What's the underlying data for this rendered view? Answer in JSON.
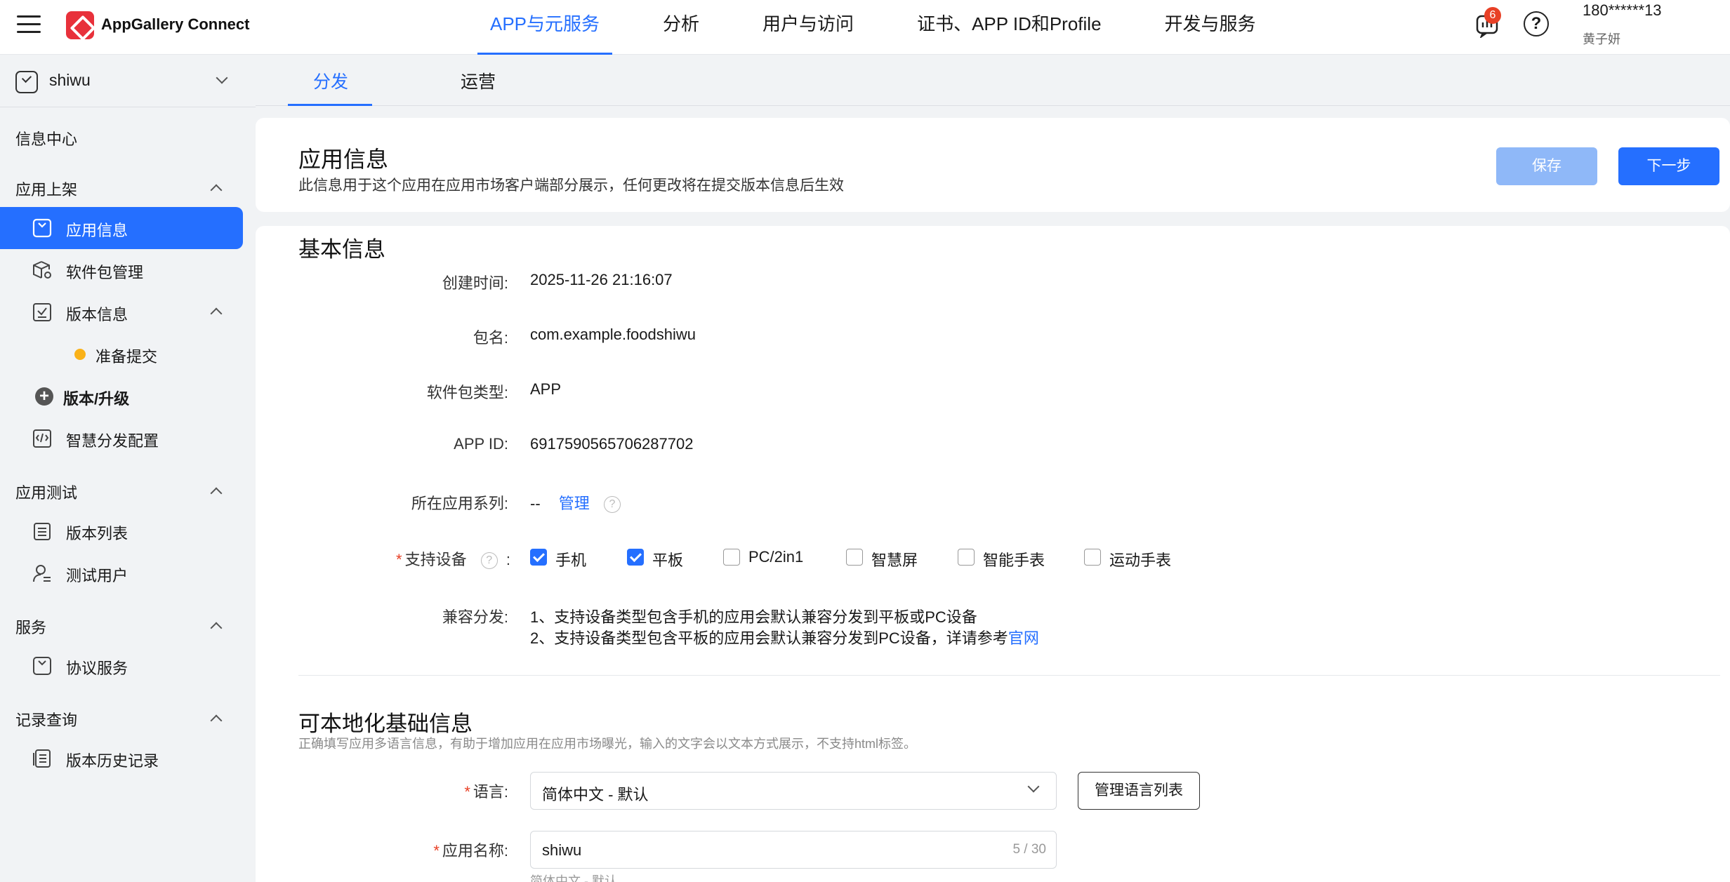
{
  "topbar": {
    "brand": "AppGallery Connect",
    "nav": [
      "APP与元服务",
      "分析",
      "用户与访问",
      "证书、APP ID和Profile",
      "开发与服务"
    ],
    "badge_count": "6",
    "help_glyph": "?",
    "user_phone": "180******13",
    "user_name": "黄子妍"
  },
  "sidebar": {
    "app_name": "shiwu",
    "info_center": "信息中心",
    "group_listing": "应用上架",
    "item_app_info": "应用信息",
    "item_package": "软件包管理",
    "item_version_info": "版本信息",
    "item_ready": "准备提交",
    "item_upgrade": "版本/升级",
    "item_smart_dist": "智慧分发配置",
    "group_testing": "应用测试",
    "item_version_list": "版本列表",
    "item_test_users": "测试用户",
    "group_service": "服务",
    "item_agreement": "协议服务",
    "group_records": "记录查询",
    "item_history": "版本历史记录"
  },
  "tabs": [
    "分发",
    "运营"
  ],
  "header": {
    "title": "应用信息",
    "subtitle": "此信息用于这个应用在应用市场客户端部分展示，任何更改将在提交版本信息后生效",
    "save_label": "保存",
    "next_label": "下一步"
  },
  "basic": {
    "title": "基本信息",
    "created_label": "创建时间:",
    "created_value": "2025-11-26 21:16:07",
    "package_label": "包名:",
    "package_value": "com.example.foodshiwu",
    "type_label": "软件包类型:",
    "type_value": "APP",
    "appid_label": "APP ID:",
    "appid_value": "6917590565706287702",
    "series_label": "所在应用系列:",
    "series_value": "--",
    "series_manage": "管理",
    "devices_label": "支持设备",
    "devices": [
      {
        "label": "手机",
        "checked": true
      },
      {
        "label": "平板",
        "checked": true
      },
      {
        "label": "PC/2in1",
        "checked": false
      },
      {
        "label": "智慧屏",
        "checked": false
      },
      {
        "label": "智能手表",
        "checked": false
      },
      {
        "label": "运动手表",
        "checked": false
      }
    ],
    "compat_label": "兼容分发:",
    "compat_line1": "1、支持设备类型包含手机的应用会默认兼容分发到平板或PC设备",
    "compat_line2": "2、支持设备类型包含平板的应用会默认兼容分发到PC设备，详请参考",
    "compat_link": "官网"
  },
  "localized": {
    "title": "可本地化基础信息",
    "hint": "正确填写应用多语言信息，有助于增加应用在应用市场曝光，输入的文字会以文本方式展示，不支持html标签。",
    "lang_label": "语言:",
    "lang_value": "简体中文 - 默认",
    "manage_lang": "管理语言列表",
    "name_label": "应用名称:",
    "name_value": "shiwu",
    "name_count": "5 / 30",
    "name_hint": "简体中文 - 默认"
  }
}
